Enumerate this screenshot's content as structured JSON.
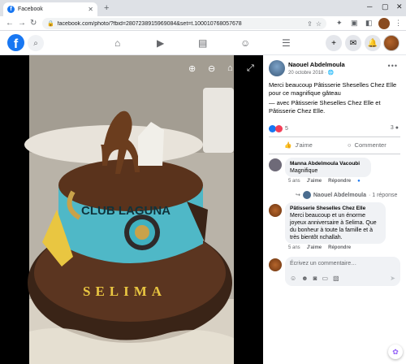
{
  "browser": {
    "tab_title": "Facebook",
    "url": "facebook.com/photo/?fbid=2807238915969084&set=t.100010768057678",
    "new_tab": "+"
  },
  "colors": {
    "facebook_blue": "#1877f2",
    "text_secondary": "#65676b",
    "bubble_bg": "#f0f2f5"
  },
  "fbnav": {
    "logo": "f"
  },
  "photo": {
    "cake_text_1": "CLUB LAGUNA",
    "cake_text_2": "SELIMA",
    "icons": [
      "zoom-in-icon",
      "zoom-out-icon",
      "tag-icon",
      "fullscreen-icon"
    ]
  },
  "post": {
    "author": "Naouel Abdelmoula",
    "date": "20 octobre 2018 · ",
    "text_1": "Merci beaucoup Pâtisserie Sheselles Chez Elle pour ce magnifique gâteau",
    "text_2": "— avec Pâtisserie Sheselles Chez Elle et Pâtisserie Chez Elle.",
    "reaction_count": "5",
    "comment_count": "3",
    "like_label": "J'aime",
    "comment_label": "Commenter"
  },
  "comments": [
    {
      "author": "Manna Abdelmoula Vacoubi",
      "text": "Magnifique",
      "time": "5 ans",
      "like": "J'aime",
      "reply": "Répondre"
    },
    {
      "author": "Pâtisserie Sheselles Chez Elle",
      "text": "Merci beaucoup et un énorme joyeux anniversaire à Selima. Que du bonheur à toute la famille et à très bientôt nchallah.",
      "time": "5 ans",
      "like": "J'aime",
      "reply": "Répondre"
    }
  ],
  "reply_preview": {
    "author": "Naouel Abdelmoula",
    "count": "· 1 réponse"
  },
  "composer": {
    "placeholder": "Écrivez un commentaire…"
  }
}
